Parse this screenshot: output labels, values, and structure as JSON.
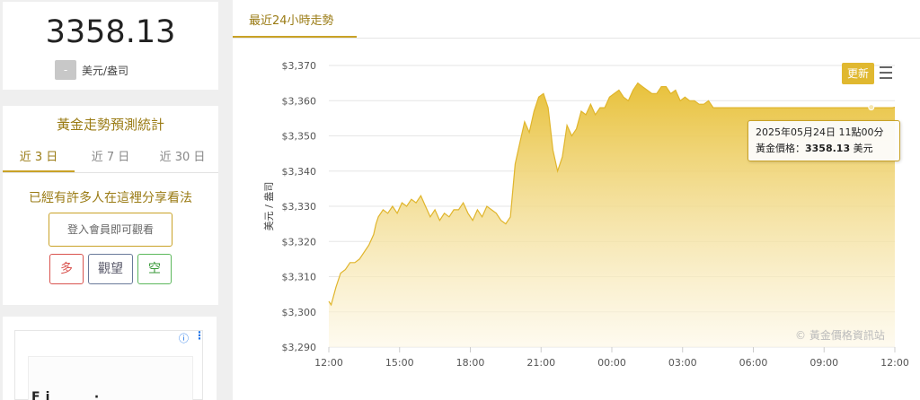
{
  "price_card": {
    "price": "3358.13",
    "change_badge": "-",
    "unit": "美元/盎司"
  },
  "forecast": {
    "title": "黃金走勢預測統計",
    "tabs": [
      "近 3 日",
      "近 7 日",
      "近 30 日"
    ],
    "share_text": "已經有許多人在這裡分享看法",
    "login_label": "登入會員即可觀看",
    "vote_bull": "多",
    "vote_wait": "觀望",
    "vote_bear": "空"
  },
  "ad": {
    "info_icon": "ⓘ",
    "menu_icon": "⋮",
    "peek_text": "Fi    ·"
  },
  "chart_tab_label": "最近24小時走勢",
  "refresh_label": "更新",
  "tooltip": {
    "line1": "2025年05月24日 11點00分",
    "label": "黃金價格：",
    "value": "3358.13",
    "unit": " 美元"
  },
  "credit": "© 黃金價格資訊站",
  "colors": {
    "accent": "#c9a227",
    "area_top": "#e8c13a",
    "area_bottom": "#fdf7e4",
    "line": "#e0b52c"
  },
  "chart_data": {
    "type": "area",
    "title": "",
    "xlabel": "",
    "ylabel": "美元 / 盎司",
    "ylim": [
      3290,
      3370
    ],
    "yticks": [
      3290,
      3300,
      3310,
      3320,
      3330,
      3340,
      3350,
      3360,
      3370
    ],
    "ytick_labels": [
      "$3,290",
      "$3,300",
      "$3,310",
      "$3,320",
      "$3,330",
      "$3,340",
      "$3,350",
      "$3,360",
      "$3,370"
    ],
    "xticks": [
      0,
      3,
      6,
      9,
      12,
      15,
      18,
      21,
      24
    ],
    "xtick_labels": [
      "12:00",
      "15:00",
      "18:00",
      "21:00",
      "00:00",
      "03:00",
      "06:00",
      "09:00",
      "12:00"
    ],
    "xlim": [
      0,
      24
    ],
    "grid": true,
    "legend": "none",
    "series": [
      {
        "x": [
          0,
          0.1,
          0.3,
          0.5,
          0.7,
          0.9,
          1.1,
          1.3,
          1.5,
          1.7,
          1.9,
          2.0,
          2.1,
          2.3,
          2.5,
          2.7,
          2.9,
          3.1,
          3.3,
          3.5,
          3.7,
          3.9,
          4.1,
          4.3,
          4.5,
          4.7,
          4.9,
          5.1,
          5.3,
          5.5,
          5.7,
          5.9,
          6.1,
          6.3,
          6.5,
          6.7,
          6.9,
          7.1,
          7.3,
          7.5,
          7.7,
          7.9,
          8.1,
          8.3,
          8.5,
          8.7,
          8.9,
          9.1,
          9.3,
          9.5,
          9.7,
          9.9,
          10.1,
          10.3,
          10.5,
          10.7,
          10.9,
          11.1,
          11.3,
          11.5,
          11.7,
          11.9,
          12.1,
          12.3,
          12.5,
          12.7,
          12.9,
          13.1,
          13.3,
          13.5,
          13.7,
          13.9,
          14.1,
          14.3,
          14.5,
          14.7,
          14.9,
          15.1,
          15.3,
          15.5,
          15.7,
          15.9,
          16.1,
          16.3,
          16.5,
          16.7,
          16.9,
          17.1,
          17.3,
          17.5,
          17.7,
          17.9,
          18.1,
          18.3,
          18.5,
          18.7,
          18.9,
          19.1,
          19.3,
          19.5,
          19.7,
          19.9,
          20.1,
          20.3,
          20.5,
          20.7,
          20.9,
          21.1,
          21.3,
          21.5,
          21.7,
          21.9,
          22.1,
          22.3,
          22.5,
          22.7,
          22.9,
          23.1,
          23.3,
          23.5,
          23.7,
          23.9,
          24.0
        ],
        "y": [
          3303,
          3302,
          3307,
          3311,
          3312,
          3314,
          3314,
          3315,
          3317,
          3319,
          3322,
          3325,
          3327,
          3329,
          3328,
          3330,
          3328,
          3331,
          3330,
          3332,
          3331,
          3333,
          3330,
          3327,
          3329,
          3326,
          3328,
          3327,
          3329,
          3329,
          3331,
          3328,
          3326,
          3329,
          3327,
          3330,
          3329,
          3328,
          3326,
          3325,
          3327,
          3342,
          3348,
          3354,
          3351,
          3357,
          3361,
          3362,
          3358,
          3346,
          3340,
          3344,
          3353,
          3350,
          3352,
          3357,
          3356,
          3359,
          3356,
          3358,
          3358,
          3361,
          3362,
          3363,
          3361,
          3360,
          3363,
          3365,
          3364,
          3363,
          3362,
          3362,
          3364,
          3364,
          3362,
          3363,
          3360,
          3361,
          3360,
          3360,
          3359,
          3359,
          3360,
          3358,
          3358,
          3358,
          3358,
          3358,
          3358,
          3358,
          3358,
          3358,
          3358,
          3358,
          3358,
          3358,
          3358,
          3358,
          3358,
          3358,
          3358,
          3358,
          3358,
          3358,
          3358,
          3358,
          3358,
          3358,
          3358,
          3358,
          3358,
          3358,
          3358,
          3358,
          3358,
          3358,
          3358,
          3358,
          3358,
          3358,
          3358,
          3358,
          3358.13
        ]
      }
    ],
    "highlight_point": {
      "x": 23.0,
      "y": 3358.13
    }
  }
}
